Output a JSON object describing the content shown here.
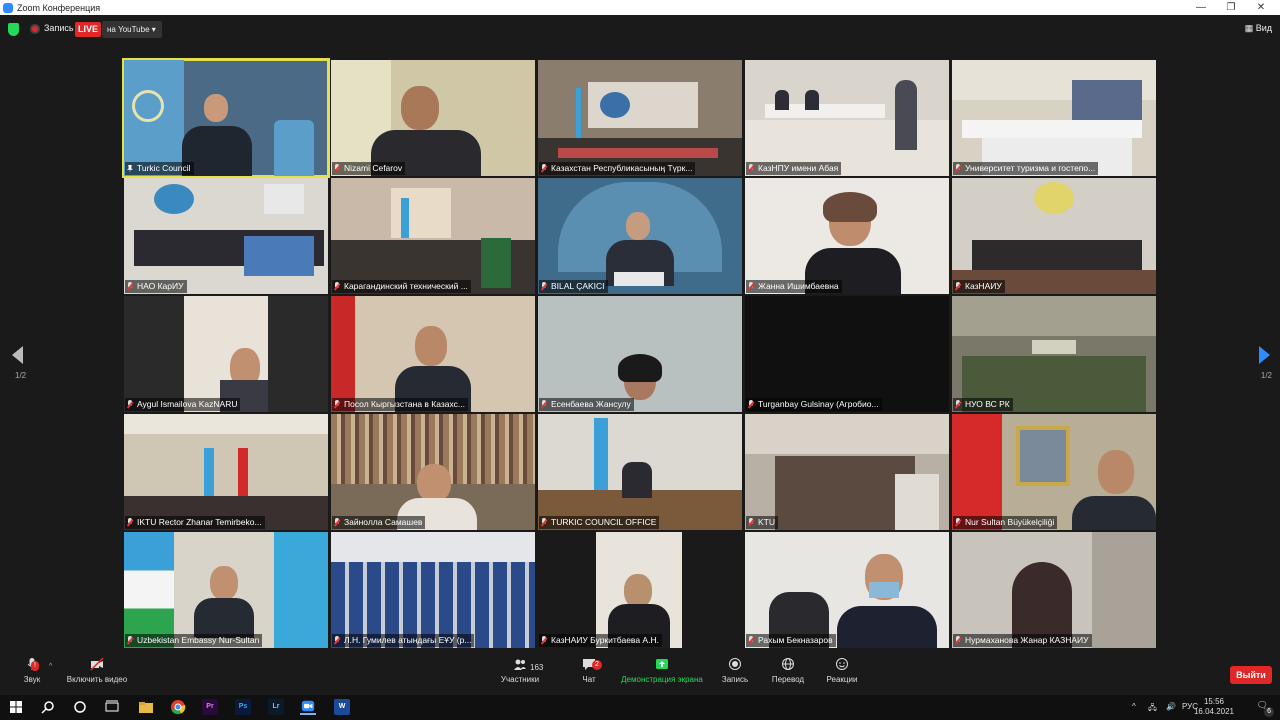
{
  "window": {
    "title": "Zoom Конференция",
    "minimize": "—",
    "restore": "❐",
    "close": "✕"
  },
  "topbar": {
    "recording_label": "Запись",
    "live_label": "LIVE",
    "youtube_label": "на YouTube ▾",
    "view_label": "Вид"
  },
  "participants": [
    {
      "name": "Turkic Council",
      "muted": false,
      "pinned": true,
      "active": true
    },
    {
      "name": "Nizami Cefarov",
      "muted": true
    },
    {
      "name": "Казахстан Республикасының Түрк...",
      "muted": true
    },
    {
      "name": "КазНПУ имени Абая",
      "muted": true
    },
    {
      "name": "Университет туризма и гостепо...",
      "muted": true
    },
    {
      "name": "НАО КарИУ",
      "muted": true
    },
    {
      "name": "Карагандинский технический ...",
      "muted": true
    },
    {
      "name": "BILAL ÇAKICI",
      "muted": true
    },
    {
      "name": "Жанна Ишимбаевна",
      "muted": true
    },
    {
      "name": "КазНАИУ",
      "muted": true
    },
    {
      "name": "Aygul Ismailova KazNARU",
      "muted": true
    },
    {
      "name": "Посол Кыргызстана в Казахс...",
      "muted": true
    },
    {
      "name": "Есенбаева Жансулу",
      "muted": true
    },
    {
      "name": "Turganbay Gulsinay (Агробио...",
      "muted": true
    },
    {
      "name": "НУО ВС РК",
      "muted": true
    },
    {
      "name": "IKTU Rector Zhanar Temirbeko...",
      "muted": true
    },
    {
      "name": "Зайнолла Самашев",
      "muted": true
    },
    {
      "name": "TURKIC COUNCIL OFFICE",
      "muted": true
    },
    {
      "name": "KTU",
      "muted": true
    },
    {
      "name": "Nur Sultan Büyükelçiliği",
      "muted": true
    },
    {
      "name": "Uzbekistan Embassy Nur-Sultan",
      "muted": true
    },
    {
      "name": "Л.Н. Гумилев атындағы ЕҰУ (р...",
      "muted": true
    },
    {
      "name": "КазНАИУ Буркитбаева А.Н.",
      "muted": true
    },
    {
      "name": "Рахым Бекназаров",
      "muted": true
    },
    {
      "name": "Нурмаханова Жанар КАЗНАИУ",
      "muted": true
    }
  ],
  "pagination": {
    "left": "1/2",
    "right": "1/2"
  },
  "toolbar": {
    "audio_label": "Звук",
    "audio_badge": "!",
    "video_label": "Включить видео",
    "participants_label": "Участники",
    "participants_count": "163",
    "chat_label": "Чат",
    "chat_badge": "2",
    "share_label": "Демонстрация экрана",
    "record_label": "Запись",
    "translate_label": "Перевод",
    "reactions_label": "Реакции",
    "leave_label": "Выйти"
  },
  "taskbar": {
    "apps": [
      "Pr",
      "Ps",
      "Lr",
      "W"
    ],
    "language": "РУС",
    "time": "15:56",
    "date": "16.04.2021",
    "notifications": "6"
  },
  "colors": {
    "accent": "#2d8cff",
    "live_red": "#e02828",
    "share_green": "#23d959",
    "active_speaker": "#e4e04a"
  }
}
